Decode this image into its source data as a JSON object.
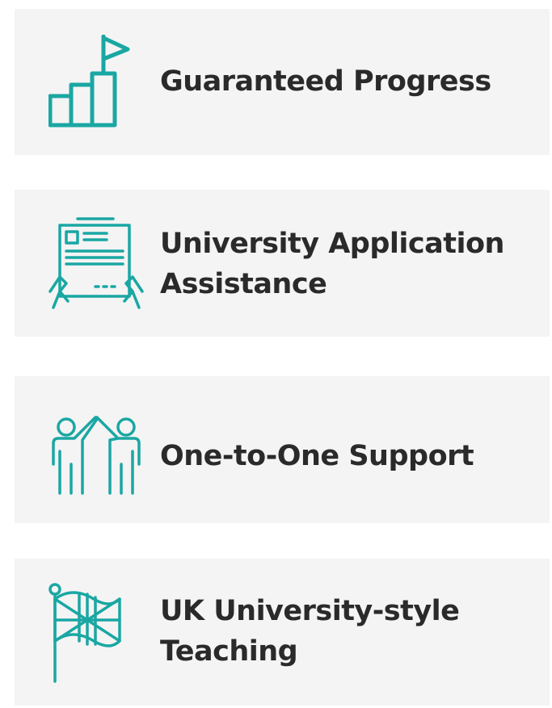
{
  "accent_color": "#1aa7a3",
  "card_background": "#f4f4f4",
  "cards": [
    {
      "icon": "progress-bars-flag-icon",
      "label": "Guaranteed Progress"
    },
    {
      "icon": "document-in-hands-icon",
      "label": "University Application Assistance"
    },
    {
      "icon": "two-people-high-five-icon",
      "label": "One-to-One Support"
    },
    {
      "icon": "union-jack-flag-icon",
      "label": "UK University-style Teaching"
    }
  ]
}
